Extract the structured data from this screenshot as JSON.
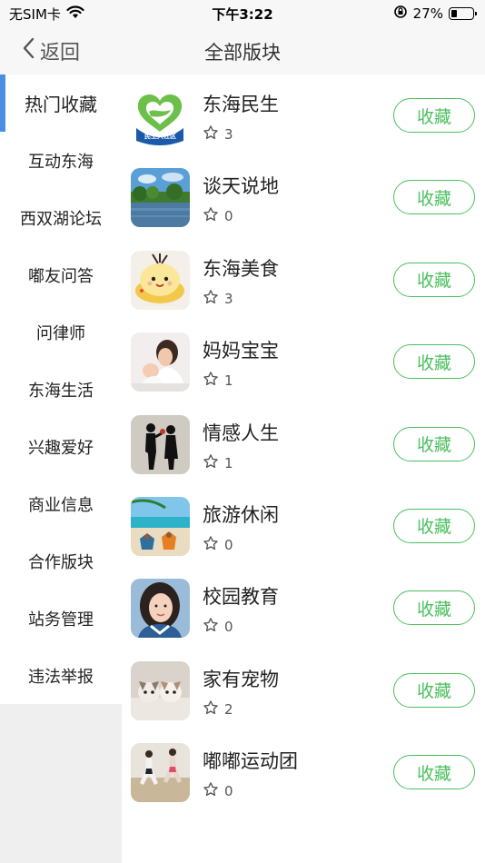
{
  "status_bar": {
    "carrier": "无SIM卡",
    "time": "下午3:22",
    "battery_percent": "27%",
    "battery_level": 0.27
  },
  "nav": {
    "back_label": "返回",
    "title": "全部版块"
  },
  "sidebar": {
    "items": [
      {
        "label": "热门收藏",
        "active": true
      },
      {
        "label": "互动东海"
      },
      {
        "label": "西双湖论坛"
      },
      {
        "label": "嘟友问答"
      },
      {
        "label": "问律师"
      },
      {
        "label": "东海生活"
      },
      {
        "label": "兴趣爱好"
      },
      {
        "label": "商业信息"
      },
      {
        "label": "合作版块"
      },
      {
        "label": "站务管理"
      },
      {
        "label": "违法举报"
      }
    ]
  },
  "forums": [
    {
      "name": "东海民生",
      "count": "3",
      "button": "收藏",
      "thumb": "logo-hands"
    },
    {
      "name": "谈天说地",
      "count": "0",
      "button": "收藏",
      "thumb": "lake"
    },
    {
      "name": "东海美食",
      "count": "3",
      "button": "收藏",
      "thumb": "dessert"
    },
    {
      "name": "妈妈宝宝",
      "count": "1",
      "button": "收藏",
      "thumb": "mother-baby"
    },
    {
      "name": "情感人生",
      "count": "1",
      "button": "收藏",
      "thumb": "silhouette-couple"
    },
    {
      "name": "旅游休闲",
      "count": "0",
      "button": "收藏",
      "thumb": "beach"
    },
    {
      "name": "校园教育",
      "count": "0",
      "button": "收藏",
      "thumb": "girl-portrait"
    },
    {
      "name": "家有宠物",
      "count": "2",
      "button": "收藏",
      "thumb": "puppies"
    },
    {
      "name": "嘟嘟运动团",
      "count": "0",
      "button": "收藏",
      "thumb": "runners"
    }
  ],
  "logo_text": "民生大社区",
  "colors": {
    "accent_green": "#4cbf5f",
    "sidebar_active_bar": "#4a90e2"
  }
}
